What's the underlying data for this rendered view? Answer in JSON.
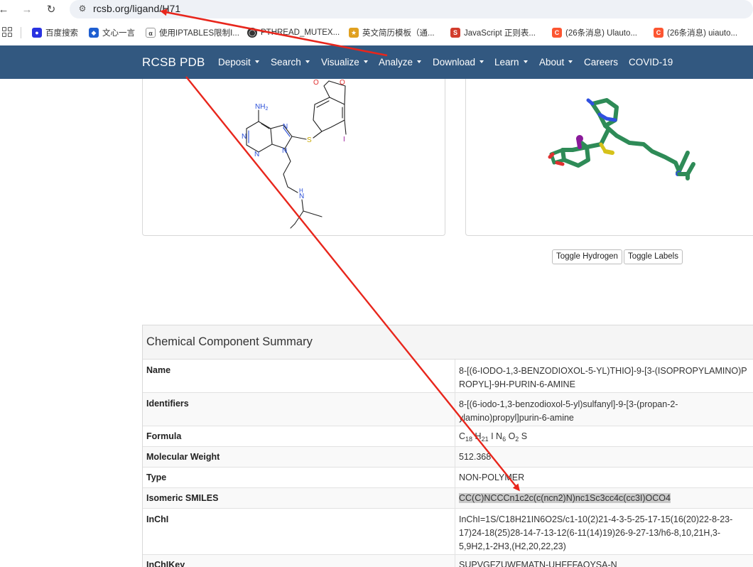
{
  "browser": {
    "url": "rcsb.org/ligand/H71",
    "bookmarks": [
      {
        "label": "百度搜索",
        "icon": "baidu-paw-icon",
        "color": "#2932e1"
      },
      {
        "label": "文心一言",
        "icon": "wenxin-cube-icon",
        "color": "#1f5fd1"
      },
      {
        "label": "使用IPTABLES限制I...",
        "icon": "bookmark-glyph-icon",
        "color": "#444444"
      },
      {
        "label": "PTHREAD_MUTEX...",
        "icon": "circle-link-icon",
        "color": "#333333"
      },
      {
        "label": "英文简历模板（通...",
        "icon": "template-site-icon",
        "color": "#e0a020"
      },
      {
        "label": "JavaScript 正则表...",
        "icon": "js-site-icon",
        "color": "#d23c2c"
      },
      {
        "label": "(26条消息) Ulauto...",
        "icon": "csdn-c-icon",
        "color": "#fc5531"
      },
      {
        "label": "(26条消息) uiauto...",
        "icon": "csdn-c-icon",
        "color": "#fc5531"
      }
    ]
  },
  "navbar": {
    "brand": "RCSB PDB",
    "items": [
      {
        "label": "Deposit",
        "dropdown": true
      },
      {
        "label": "Search",
        "dropdown": true
      },
      {
        "label": "Visualize",
        "dropdown": true
      },
      {
        "label": "Analyze",
        "dropdown": true
      },
      {
        "label": "Download",
        "dropdown": true
      },
      {
        "label": "Learn",
        "dropdown": true
      },
      {
        "label": "About",
        "dropdown": true
      },
      {
        "label": "Careers",
        "dropdown": false
      },
      {
        "label": "COVID-19",
        "dropdown": false
      }
    ],
    "color": "#325880"
  },
  "structure2d": {
    "atoms": {
      "nh2": "NH",
      "nh2_sub": "2",
      "n": "N",
      "s": "S",
      "i": "I",
      "o": "O",
      "nh": "H"
    }
  },
  "viewer_buttons": {
    "toggle_hydrogen": "Toggle Hydrogen",
    "toggle_labels": "Toggle Labels"
  },
  "summary": {
    "title": "Chemical Component Summary",
    "rows": [
      {
        "label": "Name",
        "value": "8-[(6-IODO-1,3-BENZODIOXOL-5-YL)THIO]-9-[3-(ISOPROPYLAMINO)P\nROPYL]-9H-PURIN-6-AMINE"
      },
      {
        "label": "Identifiers",
        "value": "8-[(6-iodo-1,3-benzodioxol-5-yl)sulfanyl]-9-[3-(propan-2-\nylamino)propyl]purin-6-amine"
      },
      {
        "label": "Formula",
        "value": "C18 H21 I N6 O2 S"
      },
      {
        "label": "Molecular Weight",
        "value": "512.368"
      },
      {
        "label": "Type",
        "value": "NON-POLYMER"
      },
      {
        "label": "Isomeric SMILES",
        "value": "CC(C)NCCCn1c2c(c(ncn2)N)nc1Sc3cc4c(cc3I)OCO4"
      },
      {
        "label": "InChI",
        "value": "InChI=1S/C18H21IN6O2S/c1-10(2)21-4-3-5-25-17-15(16(20)22-8-23-\n17)24-18(25)28-14-7-13-12(6-11(14)19)26-9-27-13/h6-8,10,21H,3-\n5,9H2,1-2H3,(H2,20,22,23)"
      },
      {
        "label": "InChIKey",
        "value": "SUPVGFZUWFMATN-UHFFFAOYSA-N"
      }
    ],
    "formula_parts": {
      "c": "C",
      "c_n": "18",
      "h": "H",
      "h_n": "21",
      "i": "I",
      "n": "N",
      "n_n": "6",
      "o": "O",
      "o_n": "2",
      "s": "S"
    }
  },
  "annotation_color": "#e8261c"
}
